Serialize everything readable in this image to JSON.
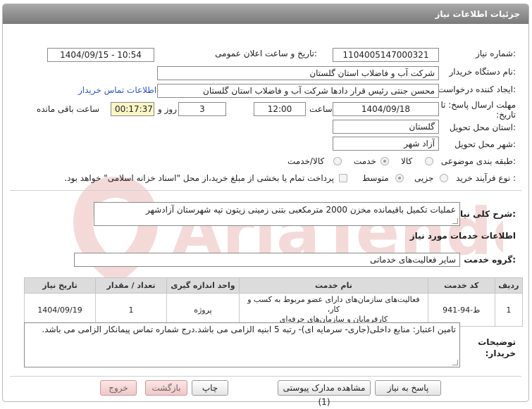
{
  "window_title": "جزئیات اطلاعات نیاز",
  "labels": {
    "need_number": "شماره نیاز:",
    "announce_datetime": "تاریخ و ساعت اعلان عمومی:",
    "buyer_org": "نام دستگاه خریدار:",
    "requester": "ایجاد کننده درخواست:",
    "buyer_contact_link": "اطلاعات تماس خریدار",
    "deadline_line1": "مهلت ارسال پاسخ: تا",
    "deadline_line2": "تاریخ:",
    "time_label": "ساعت",
    "day_label": "روز و",
    "remaining_label": "ساعت باقی مانده",
    "delivery_province": "استان محل تحویل:",
    "delivery_city": "شهر محل تحویل:",
    "category": "طبقه بندی موضوعی:",
    "process_type": "نوع فرآیند خرید :",
    "description_general": "شرح کلی نیاز:",
    "services_info": "اطلاعات خدمات مورد نیاز",
    "service_group": "گروه خدمت:",
    "buyer_notes_line1": "توضیحات",
    "buyer_notes_line2": "خریدار:"
  },
  "values": {
    "need_number": "1104005147000321",
    "announce_datetime": "1404/09/15 - 10:54",
    "buyer_org": "شرکت آب و فاضلاب استان گلستان",
    "requester": "محسن جنتی رئیس قرار دادها شرکت آب و فاضلاب استان گلستان",
    "deadline_date": "1404/09/18",
    "deadline_time": "12:00",
    "days_remaining": "3",
    "time_remaining": "00:17:37",
    "delivery_province": "گلستان",
    "delivery_city": "آزاد شهر",
    "description_general": "عملیات تکمیل باقیمانده مخزن 2000 مترمکعبی بتنی زمینی زیتون تپه شهرستان آزادشهر",
    "service_group": "سایر فعالیت‌های خدماتی",
    "buyer_notes": "تامین اعتبار: منابع داخلی(جاری- سرمایه ای)- رتبه 5 ابنیه الزامی می باشد.درج شماره تماس پیمانکار الزامی می باشد."
  },
  "category_options": [
    {
      "label": "کالا",
      "selected": false
    },
    {
      "label": "خدمت",
      "selected": true
    },
    {
      "label": "کالا/خدمت",
      "selected": false
    }
  ],
  "process_options": [
    {
      "label": "جزیی",
      "selected": false
    },
    {
      "label": "متوسط",
      "selected": true
    }
  ],
  "treasury_text": "پرداخت تمام یا بخشی از مبلغ خرید،از محل \"اسناد خزانه اسلامی\" خواهد بود.",
  "table": {
    "headers": [
      "ردیف",
      "کد خدمت",
      "نام خدمت",
      "واحد اندازه گیری",
      "تعداد / مقدار",
      "تاریخ نیاز"
    ],
    "rows": [
      {
        "row": "1",
        "code": "ط-94-941",
        "name_line1": "فعالیت‌های سازمان‌های دارای عضو مربوط به کسب و کار،",
        "name_line2": "کارفرمایان و سازمان‌های حرفه‌ای",
        "unit": "پروژه",
        "qty": "1",
        "date": "1404/09/19"
      }
    ]
  },
  "buttons": {
    "reply": "پاسخ به نیاز",
    "view_docs": "مشاهده مدارک پیوستی (1)",
    "print": "چاپ",
    "back": "بازگشت",
    "exit": "خروج"
  },
  "watermark_text": "AriaTender.net",
  "colors": {
    "title_bar": "#8c8c8c",
    "link": "#2a56c6",
    "remaining_bg": "#fbf7c5",
    "watermark": "#c0392b"
  }
}
